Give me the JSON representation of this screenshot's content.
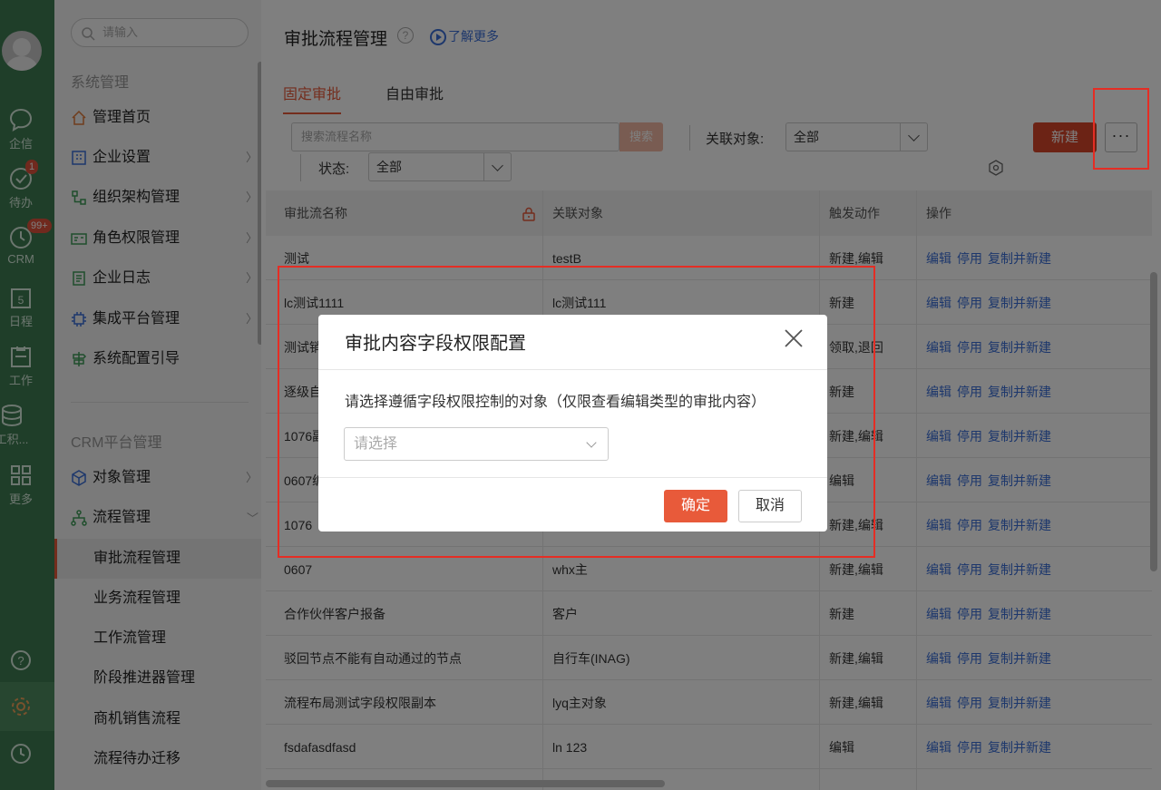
{
  "rail": {
    "items": [
      {
        "label": "企信",
        "icon": "chat-icon"
      },
      {
        "label": "待办",
        "icon": "check-icon",
        "badge": "1"
      },
      {
        "label": "CRM",
        "icon": "clock-icon",
        "badge": "99+"
      },
      {
        "label": "日程",
        "icon": "calendar-icon",
        "day": "5"
      },
      {
        "label": "工作",
        "icon": "briefcase-icon"
      },
      {
        "label": "工积...",
        "icon": "database-icon"
      },
      {
        "label": "更多",
        "icon": "grid-icon"
      }
    ]
  },
  "sidebar": {
    "search_placeholder": "请输入",
    "section1": "系统管理",
    "items": [
      {
        "label": "管理首页"
      },
      {
        "label": "企业设置"
      },
      {
        "label": "组织架构管理"
      },
      {
        "label": "角色权限管理"
      },
      {
        "label": "企业日志"
      },
      {
        "label": "集成平台管理"
      },
      {
        "label": "系统配置引导"
      }
    ],
    "section2": "CRM平台管理",
    "items2": [
      {
        "label": "对象管理"
      },
      {
        "label": "流程管理"
      }
    ],
    "subitems": [
      {
        "label": "审批流程管理"
      },
      {
        "label": "业务流程管理"
      },
      {
        "label": "工作流管理"
      },
      {
        "label": "阶段推进器管理"
      },
      {
        "label": "商机销售流程"
      },
      {
        "label": "流程待办迁移"
      }
    ]
  },
  "header": {
    "title": "审批流程管理",
    "help": "?",
    "learn_more": "了解更多"
  },
  "tabs": [
    {
      "label": "固定审批"
    },
    {
      "label": "自由审批"
    }
  ],
  "filters": {
    "search_placeholder": "搜索流程名称",
    "search_button": "搜索",
    "object_label": "关联对象:",
    "object_value": "全部",
    "status_label": "状态:",
    "status_value": "全部",
    "new_button": "新建",
    "more_button": "···"
  },
  "table": {
    "headers": [
      "审批流名称",
      "关联对象",
      "触发动作",
      "操作"
    ],
    "op_edit": "编辑",
    "op_disable": "停用",
    "op_copy": "复制并新建",
    "rows": [
      {
        "name": "测试",
        "object": "testB",
        "action": "新建,编辑"
      },
      {
        "name": "lc测试1111",
        "object": "lc测试111",
        "action": "新建"
      },
      {
        "name": "测试销",
        "object": "",
        "action": "领取,退回"
      },
      {
        "name": "逐级自",
        "object": "",
        "action": "新建"
      },
      {
        "name": "1076副",
        "object": "",
        "action": "新建,编辑"
      },
      {
        "name": "0607编",
        "object": "",
        "action": "编辑"
      },
      {
        "name": "1076",
        "object": "",
        "action": "新建,编辑"
      },
      {
        "name": "0607",
        "object": "whx主",
        "action": "新建,编辑"
      },
      {
        "name": "合作伙伴客户报备",
        "object": "客户",
        "action": "新建"
      },
      {
        "name": "驳回节点不能有自动通过的节点",
        "object": "自行车(INAG)",
        "action": "新建,编辑"
      },
      {
        "name": "流程布局测试字段权限副本",
        "object": "lyq主对象",
        "action": "新建,编辑"
      },
      {
        "name": "fsdafasdfasd",
        "object": "ln 123",
        "action": "编辑"
      }
    ]
  },
  "modal": {
    "title": "审批内容字段权限配置",
    "description": "请选择遵循字段权限控制的对象（仅限查看编辑类型的审批内容）",
    "select_placeholder": "请选择",
    "confirm": "确定",
    "cancel": "取消"
  },
  "colors": {
    "rail": "#3f7d52",
    "accent": "#e85a3a",
    "link": "#3a6fd8",
    "annotation": "#e52d24"
  }
}
